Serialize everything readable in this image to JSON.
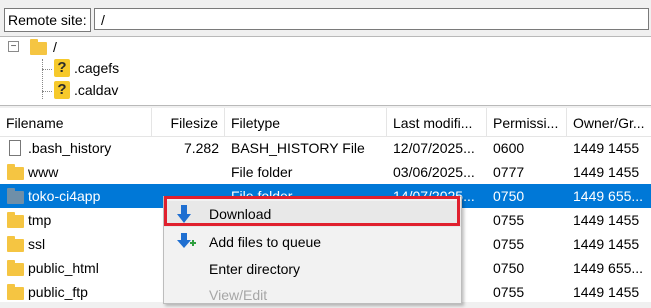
{
  "remote": {
    "label": "Remote site:",
    "path": "/"
  },
  "tree": {
    "root": "/",
    "children": [
      ".cagefs",
      ".caldav"
    ]
  },
  "columns": [
    "Filename",
    "Filesize",
    "Filetype",
    "Last modifi...",
    "Permissi...",
    "Owner/Gr..."
  ],
  "rows": [
    {
      "name": ".bash_history",
      "size": "7.282",
      "type": "BASH_HISTORY File",
      "modified": "12/07/2025...",
      "perm": "0600",
      "owner": "1449 1455"
    },
    {
      "name": "www",
      "size": "",
      "type": "File folder",
      "modified": "03/06/2025...",
      "perm": "0777",
      "owner": "1449 1455"
    },
    {
      "name": "toko-ci4app",
      "size": "",
      "type": "File folder",
      "modified": "14/07/2025...",
      "perm": "0750",
      "owner": "1449 655..."
    },
    {
      "name": "tmp",
      "size": "",
      "type": "",
      "modified": "",
      "perm": "0755",
      "owner": "1449 1455"
    },
    {
      "name": "ssl",
      "size": "",
      "type": "",
      "modified": "",
      "perm": "0755",
      "owner": "1449 1455"
    },
    {
      "name": "public_html",
      "size": "",
      "type": "",
      "modified": "",
      "perm": "0750",
      "owner": "1449 655..."
    },
    {
      "name": "public_ftp",
      "size": "",
      "type": "",
      "modified": "",
      "perm": "0755",
      "owner": "1449 1455"
    }
  ],
  "context_menu": {
    "items": [
      "Download",
      "Add files to queue",
      "Enter directory",
      "View/Edit"
    ]
  },
  "colors": {
    "selection": "#0078d7",
    "highlight_box": "#e0202e",
    "icon_blue": "#1f6fd1"
  }
}
